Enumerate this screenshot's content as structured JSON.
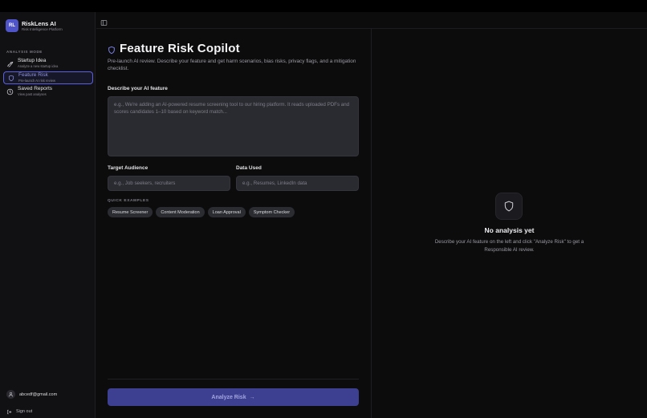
{
  "brand": {
    "initials": "RL",
    "name": "RiskLens AI",
    "subtitle": "Risk Intelligence Platform"
  },
  "sidebar": {
    "section_label": "ANALYSIS MODE",
    "items": [
      {
        "title": "Startup Idea",
        "subtitle": "Analyze a new startup idea",
        "icon": "rocket-icon",
        "active": false
      },
      {
        "title": "Feature Risk",
        "subtitle": "Pre-launch AI risk review",
        "icon": "shield-icon",
        "active": true
      },
      {
        "title": "Saved Reports",
        "subtitle": "View past analyses",
        "icon": "clock-icon",
        "active": false
      }
    ],
    "user_email": "abcedf@gmail.com",
    "signout_label": "Sign out"
  },
  "main": {
    "title": "Feature Risk Copilot",
    "description": "Pre-launch AI review. Describe your feature and get harm scenarios, bias risks, privacy flags, and a mitigation checklist.",
    "feature_label": "Describe your AI feature",
    "feature_placeholder": "e.g., We're adding an AI-powered resume screening tool to our hiring platform. It reads uploaded PDFs and scores candidates 1–10 based on keyword match...",
    "audience_label": "Target Audience",
    "audience_placeholder": "e.g., Job seekers, recruiters",
    "data_label": "Data Used",
    "data_placeholder": "e.g., Resumes, LinkedIn data",
    "quick_examples_label": "QUICK EXAMPLES",
    "quick_examples": [
      "Resume Screener",
      "Content Moderation",
      "Loan Approval",
      "Symptom Checker"
    ],
    "analyze_label": "Analyze Risk",
    "analyze_arrow": "→"
  },
  "empty_state": {
    "title": "No analysis yet",
    "description": "Describe your AI feature on the left and click \"Analyze Risk\" to get a Responsible AI review."
  },
  "colors": {
    "accent": "#5b60e0",
    "button": "#3d3f91",
    "background": "#0c0c0d"
  }
}
